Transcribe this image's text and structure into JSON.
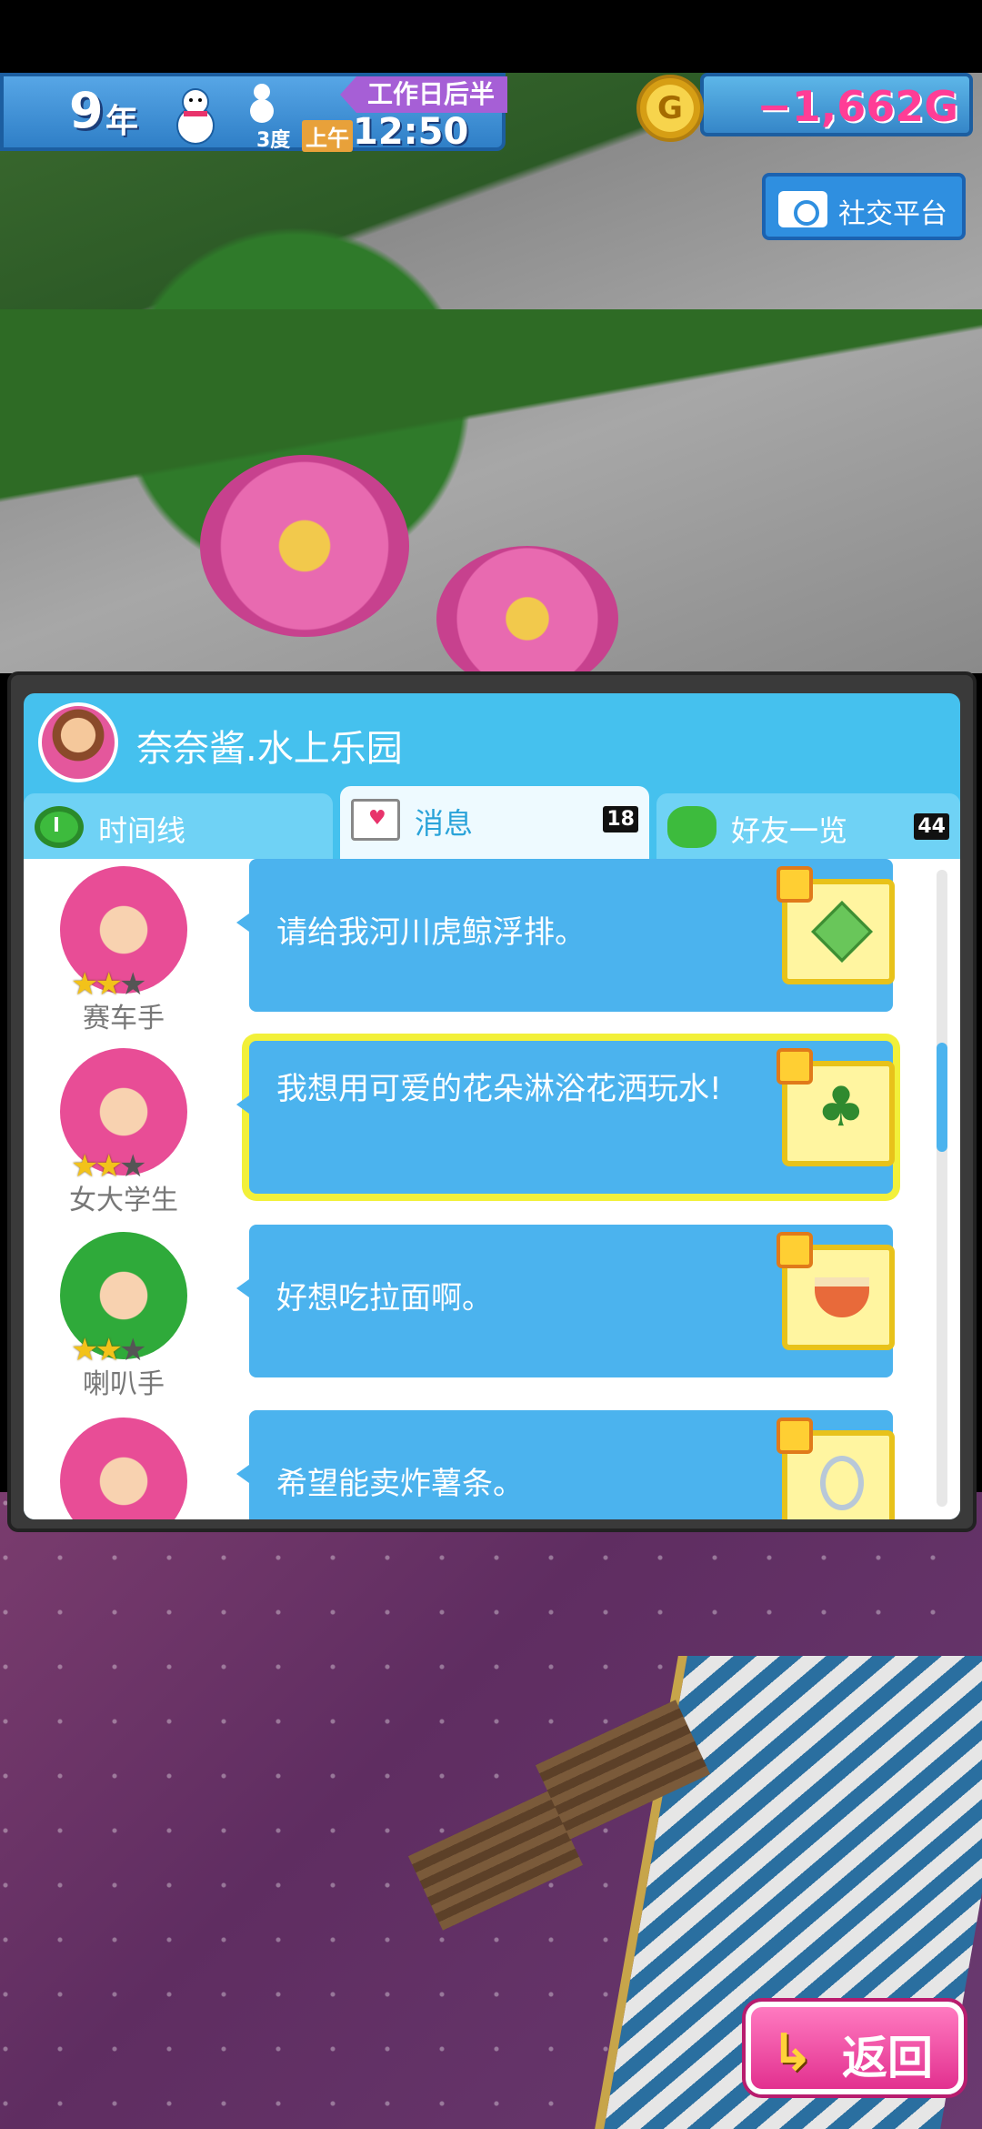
{
  "hud": {
    "year_num": "9",
    "year_label": "年",
    "temperature": "3度",
    "period": "工作日后半",
    "ampm": "上午",
    "clock": "12:50",
    "money": "−1,662G",
    "coin_letter": "G",
    "sns_label": "社交平台"
  },
  "panel": {
    "park_name": "奈奈酱.水上乐园",
    "tabs": [
      {
        "label": "时间线",
        "badge": ""
      },
      {
        "label": "消息",
        "badge": "18"
      },
      {
        "label": "好友一览",
        "badge": "44"
      }
    ],
    "messages": [
      {
        "role": "赛车手",
        "text": "请给我河川虎鲸浮排。",
        "stars": 2,
        "item": "cube-icon"
      },
      {
        "role": "女大学生",
        "text": "我想用可爱的花朵淋浴花洒玩水!",
        "stars": 2,
        "item": "palm-icon",
        "highlight": true
      },
      {
        "role": "喇叭手",
        "text": "好想吃拉面啊。",
        "stars": 2,
        "item": "ramen-icon"
      },
      {
        "role": "",
        "text": "希望能卖炸薯条。",
        "stars": 0,
        "item": "cup-icon"
      }
    ]
  },
  "back_label": "返回",
  "colors": {
    "accent": "#45c1ee",
    "highlight": "#f2f03a",
    "money": "#ff3d96",
    "back": "#e2308f"
  }
}
